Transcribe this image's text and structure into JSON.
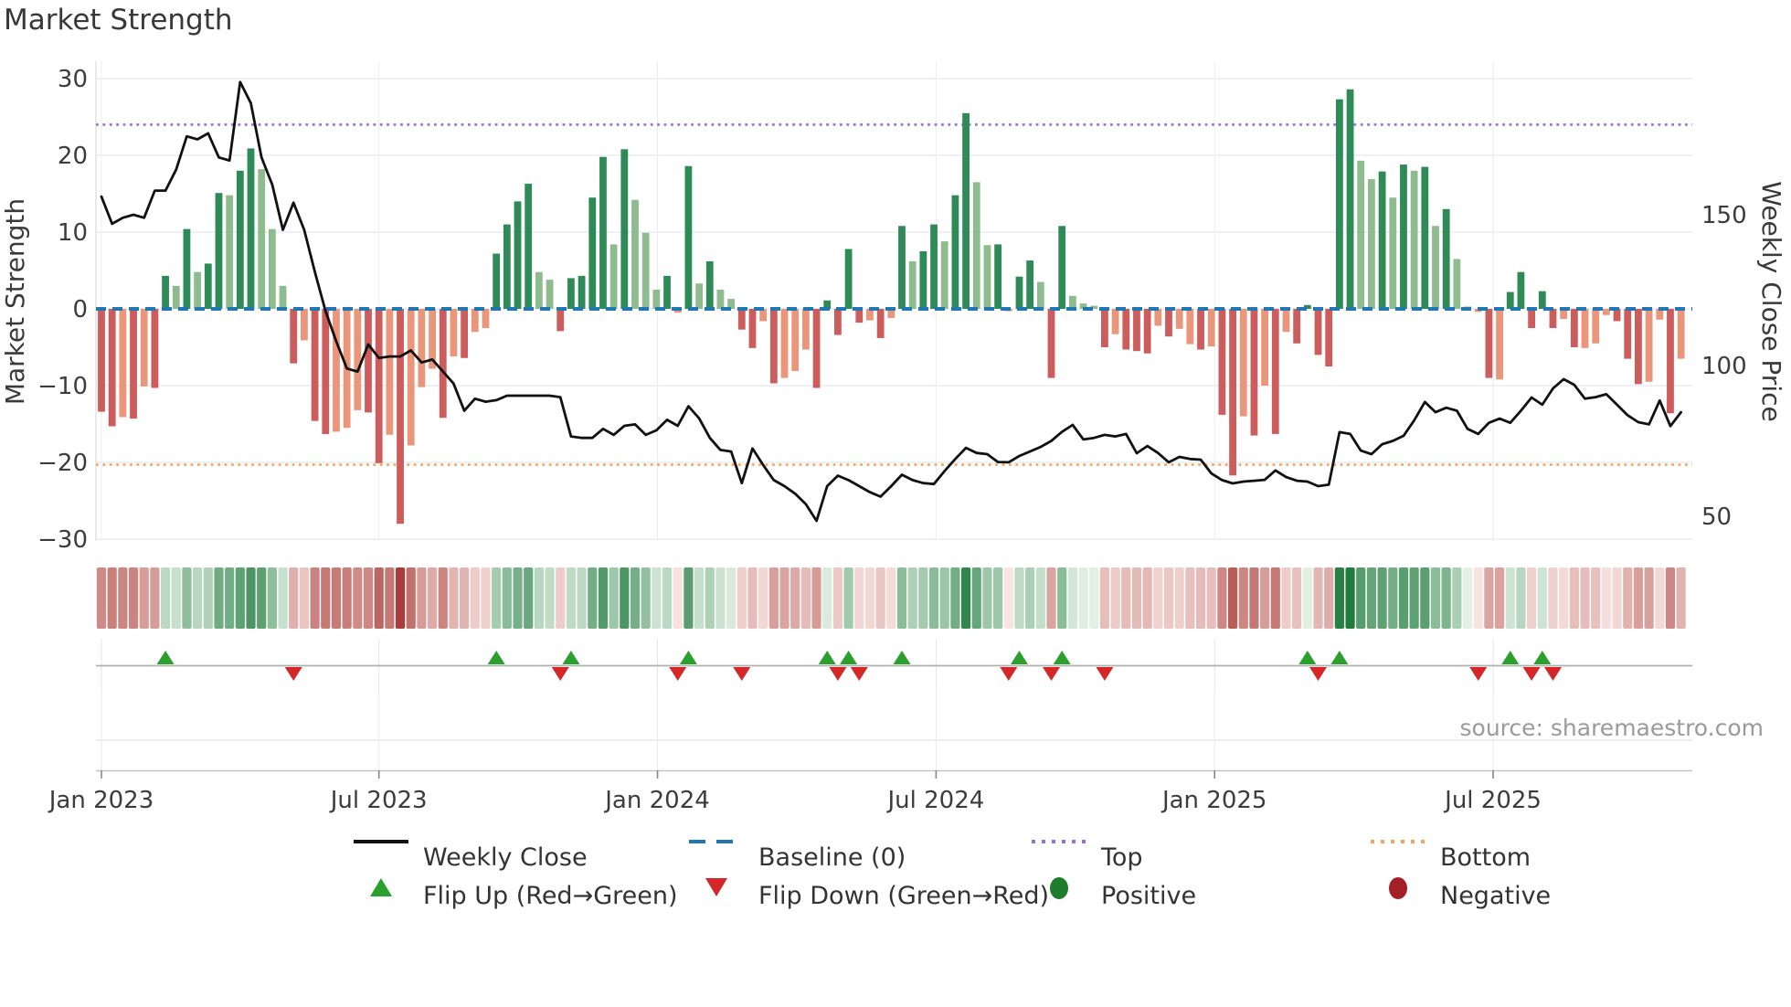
{
  "title": "Market Strength",
  "source": "source: sharemaestro.com",
  "axes": {
    "left_label": "Market Strength",
    "right_label": "Weekly Close Price",
    "left_ticks": [
      {
        "v": 30,
        "label": "30"
      },
      {
        "v": 20,
        "label": "20"
      },
      {
        "v": 10,
        "label": "10"
      },
      {
        "v": 0,
        "label": "0"
      },
      {
        "v": -10,
        "label": "−10"
      },
      {
        "v": -20,
        "label": "−20"
      },
      {
        "v": -30,
        "label": "−30"
      }
    ],
    "right_ticks": [
      {
        "p": 150,
        "label": "150"
      },
      {
        "p": 100,
        "label": "100"
      },
      {
        "p": 50,
        "label": "50"
      }
    ],
    "x_ticks": [
      {
        "week": 0,
        "label": "Jan 2023"
      },
      {
        "week": 26,
        "label": "Jul 2023"
      },
      {
        "week": 52.1,
        "label": "Jan 2024"
      },
      {
        "week": 78.2,
        "label": "Jul 2024"
      },
      {
        "week": 104.3,
        "label": "Jan 2025"
      },
      {
        "week": 130.4,
        "label": "Jul 2025"
      }
    ]
  },
  "legend": {
    "weekly_close": "Weekly Close",
    "baseline": "Baseline (0)",
    "top": "Top",
    "bottom": "Bottom",
    "flip_up": "Flip Up (Red→Green)",
    "flip_down": "Flip Down (Green→Red)",
    "positive": "Positive",
    "negative": "Negative"
  },
  "colors": {
    "positive_dark": "#2e8b57",
    "positive_light": "#8fbc8f",
    "negative_dark": "#cd5c5c",
    "negative_light": "#e9967a",
    "line": "#111111",
    "baseline": "#1f77b4",
    "top_line": "#9370db",
    "bottom_line": "#f4a460",
    "flip_up": "#2ca02c",
    "flip_down": "#d62728",
    "positive_dot": "#1e7d2c",
    "negative_dot": "#a32026",
    "grid": "#e8e8f0",
    "axis_line": "#c4c4cc",
    "tick_text": "#3c3c3c"
  },
  "chart_data": {
    "type": "bar",
    "subtype": "weekly composite: strength bars (left axis) + close price line (right axis) + heat strip + flip markers",
    "weeks": 149,
    "start_label": "Jan 2023",
    "baseline_value": 0,
    "top_value": 24,
    "bottom_value": -20.3,
    "ylim_left": [
      -32,
      32
    ],
    "ylim_right": [
      42,
      200
    ],
    "strength_values": [
      -13.4,
      -15.3,
      -14.1,
      -14.3,
      -10.1,
      -10.3,
      4.3,
      3.0,
      10.4,
      4.8,
      5.9,
      15.1,
      14.8,
      18.0,
      20.9,
      18.2,
      10.4,
      3.0,
      -7.1,
      -4.1,
      -14.6,
      -16.3,
      -16.0,
      -15.5,
      -13.2,
      -13.5,
      -20.1,
      -16.4,
      -28.0,
      -17.8,
      -10.2,
      -7.8,
      -14.2,
      -6.2,
      -6.4,
      -3.0,
      -2.5,
      7.2,
      11.0,
      14.0,
      16.3,
      4.8,
      3.8,
      -2.9,
      4.0,
      4.3,
      14.5,
      19.8,
      8.4,
      20.8,
      14.2,
      9.9,
      2.5,
      4.3,
      -0.5,
      18.6,
      3.3,
      6.2,
      2.5,
      1.3,
      -2.7,
      -5.1,
      -1.6,
      -9.7,
      -9.0,
      -8.1,
      -5.3,
      -10.3,
      1.1,
      -3.4,
      7.8,
      -1.8,
      -1.5,
      -3.8,
      -1.2,
      10.8,
      6.2,
      7.5,
      11.0,
      8.8,
      14.8,
      25.5,
      16.5,
      8.3,
      8.4,
      -0.3,
      4.2,
      6.3,
      3.5,
      -9.0,
      10.8,
      1.7,
      0.7,
      0.4,
      -5.0,
      -3.3,
      -5.3,
      -5.5,
      -5.8,
      -2.2,
      -3.6,
      -2.6,
      -4.6,
      -5.3,
      -4.9,
      -13.8,
      -21.7,
      -14.0,
      -16.5,
      -10.0,
      -16.3,
      -3.0,
      -4.5,
      0.5,
      -6.0,
      -7.5,
      27.3,
      28.6,
      19.3,
      16.9,
      17.9,
      14.5,
      18.8,
      18.0,
      18.5,
      10.8,
      13.0,
      6.5,
      0.3,
      -0.4,
      -9.0,
      -9.2,
      2.2,
      4.8,
      -2.5,
      2.3,
      -2.5,
      -1.3,
      -5.0,
      -5.1,
      -4.5,
      -0.8,
      -1.6,
      -6.5,
      -9.8,
      -9.5,
      -1.4,
      -13.6,
      -6.5
    ],
    "strength_shades": "DDLDLDDLDLDDLDDLLLDLDDLLLDDLDLLLDLDLLDDDDLLDDDDDLDLLLDLDLDLLDDLDLLLDDDDDLDLDLDDLDDLLDLDDLDDLLLDLDDDLDLLDLDDLDLDLDDDDDDLLDLDLDLDLLLDLDDDDDLDLLLDDDLLDL",
    "price_values": [
      156,
      147,
      149,
      150,
      149,
      158,
      158,
      165,
      176,
      175,
      177,
      169,
      168,
      194,
      187,
      169,
      160,
      145,
      154,
      145,
      131,
      118,
      108,
      99,
      98,
      107,
      102.5,
      103,
      103,
      105,
      101,
      102,
      98,
      94,
      85,
      89,
      88,
      88.5,
      90,
      90,
      90,
      90,
      90,
      89.5,
      76.5,
      76,
      76,
      79,
      77,
      80,
      80.5,
      77,
      78.5,
      82,
      80,
      86.5,
      82.5,
      76,
      72,
      71.5,
      61,
      72.5,
      67,
      62,
      60,
      57.5,
      54,
      48.5,
      60,
      63.5,
      62,
      60,
      58,
      56.5,
      60,
      63.8,
      62,
      61,
      60.7,
      65,
      69,
      72.7,
      71,
      70.6,
      68,
      67.9,
      70,
      71.5,
      73,
      75,
      78,
      80.3,
      75.5,
      76,
      77,
      76.5,
      77.3,
      70.9,
      73.3,
      71,
      67.9,
      69.7,
      69,
      68.8,
      64.2,
      62,
      60.9,
      61.5,
      61.8,
      62.1,
      65.2,
      63,
      61.8,
      61.5,
      60,
      60.5,
      77.9,
      77.3,
      71.8,
      70.6,
      73.9,
      75,
      76.7,
      81.8,
      87.9,
      84.5,
      86,
      85,
      79,
      77.3,
      81,
      82.4,
      81,
      85,
      89.4,
      87,
      92.4,
      95.5,
      93.6,
      89,
      89.5,
      90.5,
      87,
      83.5,
      81.2,
      80.5,
      88.4,
      79.9,
      84.5
    ],
    "flip_up_weeks": [
      6,
      37,
      44,
      55,
      68,
      70,
      75,
      86,
      90,
      113,
      116,
      132,
      135
    ],
    "flip_down_weeks": [
      18,
      43,
      54,
      60,
      69,
      71,
      85,
      89,
      94,
      114,
      129,
      134,
      136
    ]
  }
}
